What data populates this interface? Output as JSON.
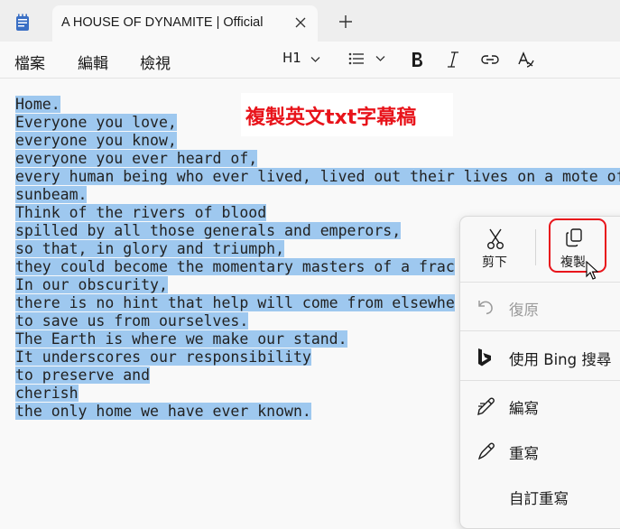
{
  "tab": {
    "title": "A HOUSE OF DYNAMITE  |  Official"
  },
  "menu": {
    "file": "檔案",
    "edit": "編輯",
    "view": "檢視"
  },
  "toolbar": {
    "heading": "H1"
  },
  "editor": {
    "lines": [
      "Home.",
      "Everyone you love,",
      "everyone you know,",
      "everyone you ever heard of,",
      "every human being who ever lived, lived out their lives on a mote of",
      "sunbeam.",
      "Think of the rivers of blood",
      "spilled by all those generals and emperors,",
      "so that, in glory and triumph,",
      "they could become the momentary masters of a frac",
      "In our obscurity,",
      "there is no hint that help will come from elsewhe",
      "to save us from ourselves.",
      "The Earth is where we make our stand.",
      "It underscores our responsibility",
      "to preserve and",
      "cherish",
      "the only home we have ever known."
    ]
  },
  "caption": {
    "text": "複製英文txt字幕稿"
  },
  "context_menu": {
    "cut": "剪下",
    "copy": "複製",
    "undo": "復原",
    "bing": "使用 Bing 搜尋",
    "compose": "編寫",
    "rewrite": "重寫",
    "custom_rewrite": "自訂重寫"
  },
  "colors": {
    "selection": "#9ec8ef",
    "annotation": "#e8141b"
  }
}
